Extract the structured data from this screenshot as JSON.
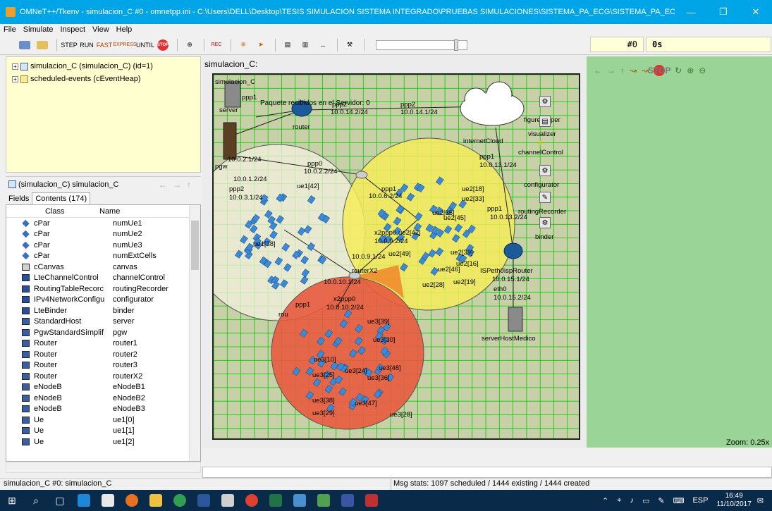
{
  "window": {
    "title": "OMNeT++/Tkenv - simulacion_C #0 - omnetpp.ini - C:\\Users\\DELL\\Desktop\\TESIS SIMULACION SISTEMA INTEGRADO\\PRUEBAS SIMULACIONES\\SISTEMA_PA_ECG\\SISTEMA_PA_ECG\\inet\\examples\\sistema_pa...",
    "minimize": "—",
    "restore": "❐",
    "close": "✕"
  },
  "menu": [
    "File",
    "Simulate",
    "Inspect",
    "View",
    "Help"
  ],
  "toolbar": {
    "step": "STEP",
    "run": "RUN",
    "fast": "FAST",
    "express": "EXPRESS",
    "until": "UNTIL",
    "stop": "STOP",
    "rec": "REC",
    "event_number": "#0",
    "sim_time": "0s"
  },
  "tree": [
    {
      "label": "simulacion_C (simulacion_C) (id=1)"
    },
    {
      "label": "scheduled-events (cEventHeap)"
    }
  ],
  "inspector": {
    "title": "(simulacion_C) simulacion_C",
    "tabs": [
      "Fields",
      "Contents (174)"
    ],
    "col_class": "Class",
    "col_name": "Name",
    "rows": [
      {
        "cls": "cPar",
        "name": "numUe1",
        "icon": "diamond"
      },
      {
        "cls": "cPar",
        "name": "numUe2",
        "icon": "diamond"
      },
      {
        "cls": "cPar",
        "name": "numUe3",
        "icon": "diamond"
      },
      {
        "cls": "cPar",
        "name": "numExtCells",
        "icon": "diamond"
      },
      {
        "cls": "cCanvas",
        "name": "canvas",
        "icon": "canvas"
      },
      {
        "cls": "LteChannelControl",
        "name": "channelControl",
        "icon": "module"
      },
      {
        "cls": "RoutingTableRecorc",
        "name": "routingRecorder",
        "icon": "module"
      },
      {
        "cls": "IPv4NetworkConfigu",
        "name": "configurator",
        "icon": "module"
      },
      {
        "cls": "LteBinder",
        "name": "binder",
        "icon": "module"
      },
      {
        "cls": "StandardHost",
        "name": "server",
        "icon": "compound"
      },
      {
        "cls": "PgwStandardSimplif",
        "name": "pgw",
        "icon": "compound"
      },
      {
        "cls": "Router",
        "name": "router1",
        "icon": "compound"
      },
      {
        "cls": "Router",
        "name": "router2",
        "icon": "compound"
      },
      {
        "cls": "Router",
        "name": "router3",
        "icon": "compound"
      },
      {
        "cls": "Router",
        "name": "routerX2",
        "icon": "compound"
      },
      {
        "cls": "eNodeB",
        "name": "eNodeB1",
        "icon": "compound"
      },
      {
        "cls": "eNodeB",
        "name": "eNodeB2",
        "icon": "compound"
      },
      {
        "cls": "eNodeB",
        "name": "eNodeB3",
        "icon": "compound"
      },
      {
        "cls": "Ue",
        "name": "ue1[0]",
        "icon": "compound"
      },
      {
        "cls": "Ue",
        "name": "ue1[1]",
        "icon": "compound"
      },
      {
        "cls": "Ue",
        "name": "ue1[2]",
        "icon": "compound"
      }
    ]
  },
  "network": {
    "title": "simulacion_C:",
    "module_name": "simulacion_C",
    "packet_msg": "Paquete recibidos en el Servidor: 0",
    "server": "server",
    "router": "router",
    "internet": "internetCloud",
    "ppp1_top": "ppp1",
    "ppp2_a": "ppp2",
    "ip_a": "10.0.14.2/24",
    "ppp2_b": "ppp2",
    "ip_b": "10.0.14.1/24",
    "ppp1_c": "ppp1",
    "ip_c": "10.0.13.1/24",
    "ppp1_d": "ppp1",
    "ip_d": "10.0.13.2/24",
    "isp": "ISPeth0",
    "isp_router": "ispRouter",
    "ip_e": "10.0.15.1/24",
    "eth0": "eth0",
    "ip_f": "10.0.15.2/24",
    "medico": "serverHostMedico",
    "pgw": "pgw",
    "ip_g": "10.0.2.1/24",
    "ppp0_a": "ppp0",
    "ip_h": "10.0.2.2/24",
    "ip_i": "10.0.1.2/24",
    "ppp2_c": "ppp2",
    "ip_j": "10.0.3.1/24",
    "ppp_lbl": "ppp1",
    "ip_k": "10.0.6.2/24",
    "ue1_42": "ue1[42]",
    "ue1_38": "ue1[38]",
    "ue2_18": "ue2[18]",
    "ue2_33": "ue2[33]",
    "ue2_45": "ue2[45]",
    "ue2_35": "ue2[35]",
    "ue2_42": "ue2[42]",
    "ue2_49": "ue2[49]",
    "ue2_39": "ue2[39]",
    "ue2_46": "ue2[46]",
    "ue2_16": "ue2[16]",
    "ue2_19": "ue2[19]",
    "ue2_28": "ue2[28]",
    "ue3_39": "ue3[39]",
    "ue3_30": "ue3[30]",
    "ue3_48": "ue3[48]",
    "ue3_36": "ue3[36]",
    "ue3_25": "ue3[25]",
    "ue3_38": "ue3[38]",
    "ue3_47": "ue3[47]",
    "ue3_29": "ue3[29]",
    "ue3_10": "ue3[10]",
    "ue3_24": "ue3[24]",
    "ue3_28": "ue3[28]",
    "routerX2": "routerX2",
    "x2ppp0": "x2ppp0",
    "ip_x1": "10.0.9.2/24",
    "ip_x2": "10.0.9.1/24",
    "ip_x3": "10.0.10.1/24",
    "ip_x4": "10.0.10.2/24",
    "ppp1_x": "ppp1",
    "router_x": "rou",
    "figureHelper": "figureHelper",
    "visualizer": "visualizer",
    "channelControl": "channelControl",
    "configurator": "configurator",
    "routingRecorder": "routingRecorder",
    "binder": "binder",
    "cell_colors": {
      "cell1": "#f2f0dc",
      "cell2": "#f5ec5a",
      "cell3": "#e85a3e",
      "overlap": "#f0862a"
    },
    "grid_color": "#00cc00",
    "background_color": "#c8d0a8"
  },
  "right_zoom": "Zoom: 0.25x",
  "status": {
    "left": "simulacion_C #0: simulacion_C",
    "right": "Msg stats: 1097 scheduled / 1444 existing / 1444 created"
  },
  "taskbar": {
    "lang": "ESP",
    "time": "16:49",
    "date": "11/10/2017"
  }
}
